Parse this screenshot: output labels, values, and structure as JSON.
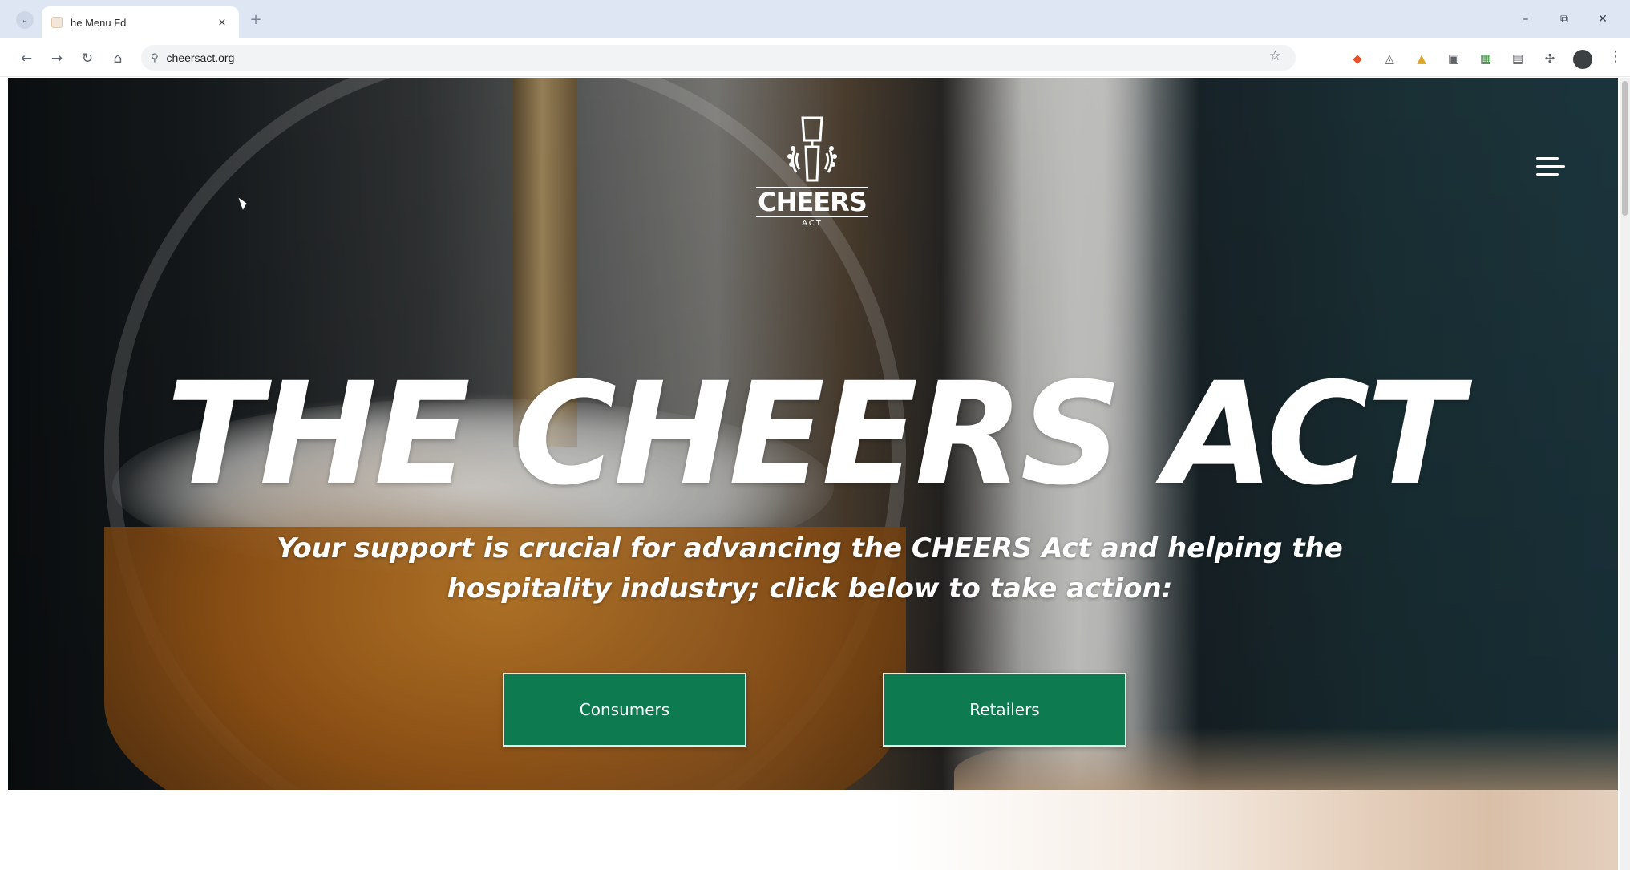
{
  "browser": {
    "tab_title": "he Menu Fd",
    "tab_close": "×",
    "new_tab": "+",
    "window_controls": [
      "–",
      "⧉",
      "✕"
    ],
    "url": "cheersact.org",
    "icons": [
      "back-arrow-icon",
      "forward-arrow-icon",
      "reload-icon",
      "home-icon",
      "site-info-icon",
      "bookmark-star-icon",
      "extensions-icon",
      "profile-avatar-icon",
      "more-menu-icon"
    ]
  },
  "page": {
    "logo_word": "CHEERS",
    "logo_sub": "ACT",
    "headline": "THE CHEERS ACT",
    "subhead": "Your support is crucial for advancing the CHEERS Act and helping the hospitality industry; click below to take action:",
    "buttons": {
      "consumers": "Consumers",
      "retailers": "Retailers"
    }
  },
  "colors": {
    "cta_green": "#0d7a4f",
    "headline": "#ffffff",
    "tab_bar": "#dfe6f3"
  }
}
